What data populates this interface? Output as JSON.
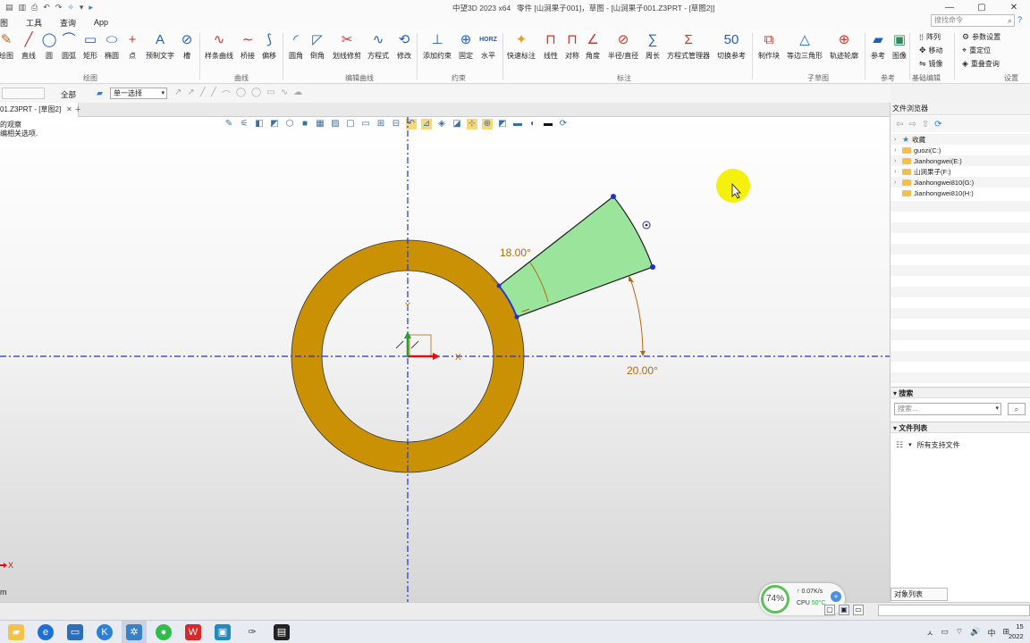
{
  "window": {
    "app_title": "中望3D 2023 x64",
    "doc_title": "零件 [山涧果子001]，草图 - [山涧果子001.Z3PRT - [草图2]]",
    "controls": [
      "—",
      "▢",
      "✕"
    ]
  },
  "menu": {
    "items": [
      "图",
      "工具",
      "查询",
      "App"
    ],
    "search_placeholder": "搜找命令"
  },
  "ribbon": {
    "buttons": [
      {
        "label": "绘图",
        "icon": "✎",
        "color": "#c8611b"
      },
      {
        "label": "直线",
        "icon": "╱",
        "color": "#c0392b"
      },
      {
        "label": "圆",
        "icon": "◯",
        "color": "#1f5fbf"
      },
      {
        "label": "圆弧",
        "icon": "⌒",
        "color": "#1f5fbf"
      },
      {
        "label": "矩形",
        "icon": "▭",
        "color": "#1f5fbf"
      },
      {
        "label": "椭圆",
        "icon": "⬭",
        "color": "#1f5fbf"
      },
      {
        "label": "点",
        "icon": "+",
        "color": "#c0392b"
      },
      {
        "label": "预制文字",
        "icon": "A",
        "color": "#1f5fbf"
      },
      {
        "label": "槽",
        "icon": "⊘",
        "color": "#1f5fbf"
      },
      {
        "label": "样条曲线",
        "icon": "∿",
        "color": "#c0392b"
      },
      {
        "label": "桥接",
        "icon": "∼",
        "color": "#c0392b"
      },
      {
        "label": "偏移",
        "icon": "⟆",
        "color": "#1f5fbf"
      },
      {
        "label": "圆角",
        "icon": "◜",
        "color": "#1f5fbf"
      },
      {
        "label": "倒角",
        "icon": "◸",
        "color": "#1f5fbf"
      },
      {
        "label": "划线修剪",
        "icon": "✂",
        "color": "#c0392b"
      },
      {
        "label": "方程式",
        "icon": "∿",
        "color": "#1f5fbf"
      },
      {
        "label": "修改",
        "icon": "⟲",
        "color": "#1f5fbf"
      },
      {
        "label": "添加约束",
        "icon": "⊥",
        "color": "#1f5fbf"
      },
      {
        "label": "固定",
        "icon": "⊕",
        "color": "#1f5fbf"
      },
      {
        "label": "水平",
        "icon": "HORZ",
        "color": "#1f5fbf"
      },
      {
        "label": "快速标注",
        "icon": "✦",
        "color": "#e3a21a"
      },
      {
        "label": "线性",
        "icon": "⊓",
        "color": "#c0392b"
      },
      {
        "label": "对称",
        "icon": "⊓",
        "color": "#c0392b"
      },
      {
        "label": "角度",
        "icon": "∠",
        "color": "#c0392b"
      },
      {
        "label": "半径/直径",
        "icon": "⊘",
        "color": "#c0392b"
      },
      {
        "label": "周长",
        "icon": "∑",
        "color": "#1f5fbf"
      },
      {
        "label": "方程式管理器",
        "icon": "Σ",
        "color": "#c0392b"
      },
      {
        "label": "切换参考",
        "icon": "50",
        "color": "#1f5fbf"
      },
      {
        "label": "制作块",
        "icon": "⧉",
        "color": "#c0392b"
      },
      {
        "label": "等边三角形",
        "icon": "△",
        "color": "#1f5fbf"
      },
      {
        "label": "轨迹轮廓",
        "icon": "⊕",
        "color": "#c0392b"
      },
      {
        "label": "参考",
        "icon": "▰",
        "color": "#1f5fbf"
      },
      {
        "label": "图像",
        "icon": "▣",
        "color": "#2e8b57"
      }
    ],
    "groups": [
      "绘图",
      "曲线",
      "编辑曲线",
      "约束",
      "标注",
      "子草图",
      "参考",
      "基础编辑",
      "设置"
    ],
    "side_buttons": [
      {
        "label": "阵列",
        "icon": "⁞⁞"
      },
      {
        "label": "移动",
        "icon": "✥"
      },
      {
        "label": "镜像",
        "icon": "⇋"
      },
      {
        "label": "参数设置",
        "icon": "⚙"
      },
      {
        "label": "重定位",
        "icon": "⌖"
      },
      {
        "label": "重叠查询",
        "icon": "◈"
      }
    ]
  },
  "filter_bar": {
    "scope": "全部",
    "pick_mode": "单一选择"
  },
  "doc_tab": {
    "label": "01.Z3PRT - [草图2]",
    "close": "✕",
    "add": "+"
  },
  "canvas": {
    "hint_lines": [
      "的观察",
      "编相关选项."
    ],
    "dims": {
      "angle1": "18.00°",
      "angle2": "20.00°"
    },
    "axis_labels": {
      "y": "Y",
      "x": "X",
      "corner_x": "X"
    },
    "unit": "m"
  },
  "status": {
    "net_percent": "74%",
    "net_speed": "0.07K/s",
    "cpu_label": "CPU",
    "cpu_temp": "50°C"
  },
  "right_panel": {
    "title": "文件浏览器",
    "tree": [
      {
        "label": "收藏",
        "kind": "star"
      },
      {
        "label": "guozi(C:)",
        "kind": "folder"
      },
      {
        "label": "Jianhongwei(E:)",
        "kind": "folder"
      },
      {
        "label": "山涧果子(F:)",
        "kind": "folder"
      },
      {
        "label": "Jianhongwei810(G:)",
        "kind": "folder"
      },
      {
        "label": "Jianhongwei810(H:)",
        "kind": "folder"
      }
    ],
    "search_section": "搜索",
    "search_placeholder": "搜索...",
    "file_list_section": "文件列表",
    "file_filter": "所有支持文件",
    "bottom_tab": "对象列表"
  },
  "taskbar": {
    "tray": [
      "ㅅ",
      "▭",
      "⌔",
      "🔊",
      "中",
      "⊞"
    ],
    "time": "15",
    "date": "2022"
  }
}
